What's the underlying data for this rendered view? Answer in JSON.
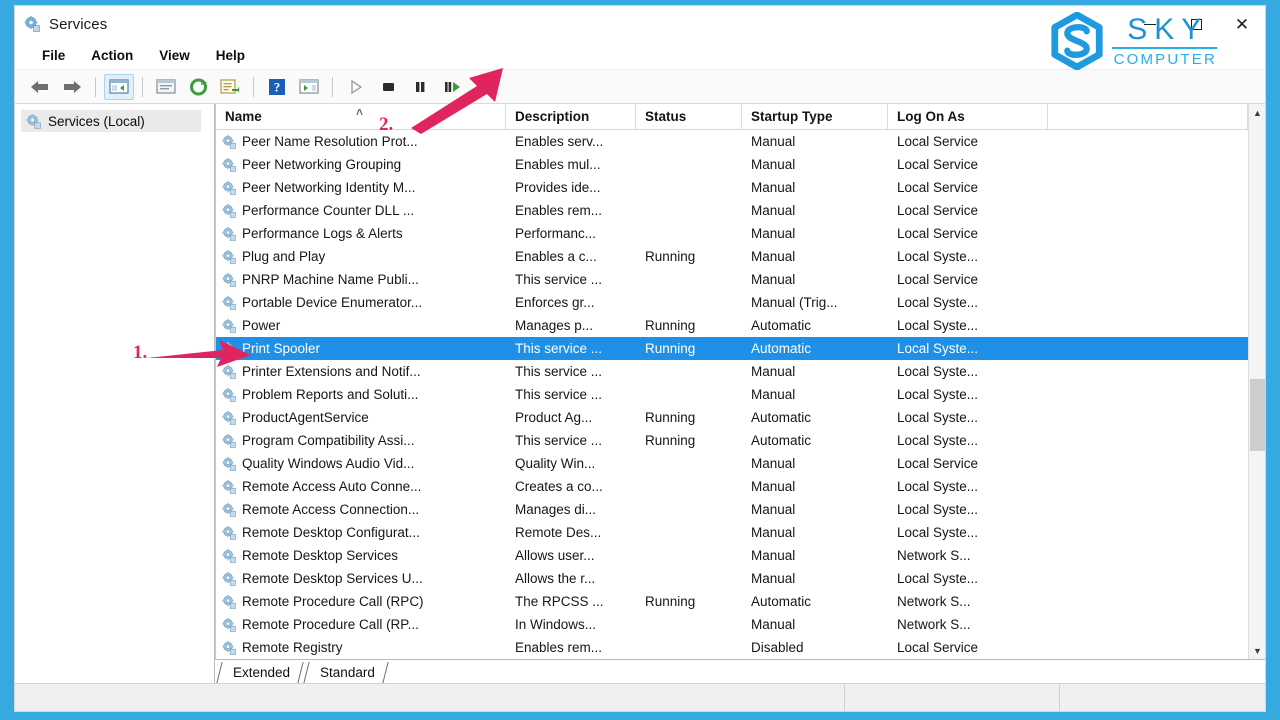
{
  "window": {
    "title": "Services",
    "icon": "services-gear-icon",
    "buttons": {
      "minimize": "–",
      "maximize": "□",
      "close": "✕"
    }
  },
  "logo": {
    "primary": "SKY",
    "secondary": "COMPUTER",
    "color": "#1F8FD6"
  },
  "menubar": {
    "items": [
      "File",
      "Action",
      "View",
      "Help"
    ]
  },
  "toolbar": {
    "buttons": [
      {
        "name": "back-arrow-icon",
        "title": "Back"
      },
      {
        "name": "forward-arrow-icon",
        "title": "Forward"
      },
      {
        "name": "show-hide-console-tree-icon",
        "title": "Show/Hide Console Tree"
      },
      {
        "name": "properties-icon",
        "title": "Properties"
      },
      {
        "name": "refresh-icon",
        "title": "Refresh"
      },
      {
        "name": "export-list-icon",
        "title": "Export List"
      },
      {
        "name": "help-icon",
        "title": "Help"
      },
      {
        "name": "show-hide-action-pane-icon",
        "title": "Show/Hide Action Pane"
      },
      {
        "name": "start-service-icon",
        "title": "Start Service"
      },
      {
        "name": "stop-service-icon",
        "title": "Stop Service"
      },
      {
        "name": "pause-service-icon",
        "title": "Pause Service"
      },
      {
        "name": "restart-service-icon",
        "title": "Restart Service"
      }
    ]
  },
  "tree": {
    "root_label": "Services (Local)"
  },
  "table": {
    "columns": [
      "Name",
      "Description",
      "Status",
      "Startup Type",
      "Log On As"
    ],
    "sort_column": "Name",
    "sort_indicator": "˄",
    "rows": [
      {
        "name": "Peer Name Resolution Prot...",
        "description": "Enables serv...",
        "status": "",
        "startup": "Manual",
        "logon": "Local Service",
        "selected": false
      },
      {
        "name": "Peer Networking Grouping",
        "description": "Enables mul...",
        "status": "",
        "startup": "Manual",
        "logon": "Local Service",
        "selected": false
      },
      {
        "name": "Peer Networking Identity M...",
        "description": "Provides ide...",
        "status": "",
        "startup": "Manual",
        "logon": "Local Service",
        "selected": false
      },
      {
        "name": "Performance Counter DLL ...",
        "description": "Enables rem...",
        "status": "",
        "startup": "Manual",
        "logon": "Local Service",
        "selected": false
      },
      {
        "name": "Performance Logs & Alerts",
        "description": "Performanc...",
        "status": "",
        "startup": "Manual",
        "logon": "Local Service",
        "selected": false
      },
      {
        "name": "Plug and Play",
        "description": "Enables a c...",
        "status": "Running",
        "startup": "Manual",
        "logon": "Local Syste...",
        "selected": false
      },
      {
        "name": "PNRP Machine Name Publi...",
        "description": "This service ...",
        "status": "",
        "startup": "Manual",
        "logon": "Local Service",
        "selected": false
      },
      {
        "name": "Portable Device Enumerator...",
        "description": "Enforces gr...",
        "status": "",
        "startup": "Manual (Trig...",
        "logon": "Local Syste...",
        "selected": false
      },
      {
        "name": "Power",
        "description": "Manages p...",
        "status": "Running",
        "startup": "Automatic",
        "logon": "Local Syste...",
        "selected": false
      },
      {
        "name": "Print Spooler",
        "description": "This service ...",
        "status": "Running",
        "startup": "Automatic",
        "logon": "Local Syste...",
        "selected": true
      },
      {
        "name": "Printer Extensions and Notif...",
        "description": "This service ...",
        "status": "",
        "startup": "Manual",
        "logon": "Local Syste...",
        "selected": false
      },
      {
        "name": "Problem Reports and Soluti...",
        "description": "This service ...",
        "status": "",
        "startup": "Manual",
        "logon": "Local Syste...",
        "selected": false
      },
      {
        "name": "ProductAgentService",
        "description": "Product Ag...",
        "status": "Running",
        "startup": "Automatic",
        "logon": "Local Syste...",
        "selected": false
      },
      {
        "name": "Program Compatibility Assi...",
        "description": "This service ...",
        "status": "Running",
        "startup": "Automatic",
        "logon": "Local Syste...",
        "selected": false
      },
      {
        "name": "Quality Windows Audio Vid...",
        "description": "Quality Win...",
        "status": "",
        "startup": "Manual",
        "logon": "Local Service",
        "selected": false
      },
      {
        "name": "Remote Access Auto Conne...",
        "description": "Creates a co...",
        "status": "",
        "startup": "Manual",
        "logon": "Local Syste...",
        "selected": false
      },
      {
        "name": "Remote Access Connection...",
        "description": "Manages di...",
        "status": "",
        "startup": "Manual",
        "logon": "Local Syste...",
        "selected": false
      },
      {
        "name": "Remote Desktop Configurat...",
        "description": "Remote Des...",
        "status": "",
        "startup": "Manual",
        "logon": "Local Syste...",
        "selected": false
      },
      {
        "name": "Remote Desktop Services",
        "description": "Allows user...",
        "status": "",
        "startup": "Manual",
        "logon": "Network S...",
        "selected": false
      },
      {
        "name": "Remote Desktop Services U...",
        "description": "Allows the r...",
        "status": "",
        "startup": "Manual",
        "logon": "Local Syste...",
        "selected": false
      },
      {
        "name": "Remote Procedure Call (RPC)",
        "description": "The RPCSS ...",
        "status": "Running",
        "startup": "Automatic",
        "logon": "Network S...",
        "selected": false
      },
      {
        "name": "Remote Procedure Call (RP...",
        "description": "In Windows...",
        "status": "",
        "startup": "Manual",
        "logon": "Network S...",
        "selected": false
      },
      {
        "name": "Remote Registry",
        "description": "Enables rem...",
        "status": "",
        "startup": "Disabled",
        "logon": "Local Service",
        "selected": false
      }
    ]
  },
  "tabs": [
    {
      "label": "Extended",
      "active": true
    },
    {
      "label": "Standard",
      "active": false
    }
  ],
  "annotations": [
    {
      "id": "1",
      "label": "1.",
      "points_to": "print-spooler-row"
    },
    {
      "id": "2",
      "label": "2.",
      "points_to": "restart-service-icon"
    }
  ],
  "colors": {
    "frame": "#36A9E1",
    "selection": "#1E90E8",
    "annotation": "#E0245E",
    "toolbar_bg": "#fafafa"
  }
}
